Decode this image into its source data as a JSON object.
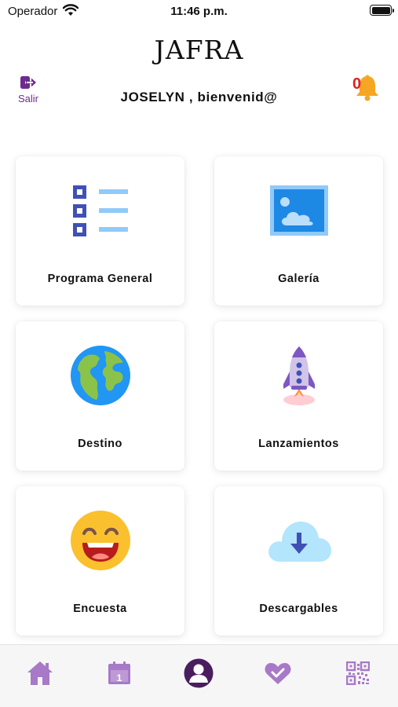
{
  "status_bar": {
    "carrier": "Operador",
    "time": "11:46 p.m."
  },
  "header": {
    "brand": "JAFRA",
    "logout_label": "Salir",
    "welcome": "JOSELYN , bienvenid@",
    "notification_count": "0"
  },
  "menu": {
    "items": [
      {
        "label": "Programa General",
        "icon": "checklist-icon"
      },
      {
        "label": "Galería",
        "icon": "picture-icon"
      },
      {
        "label": "Destino",
        "icon": "globe-icon"
      },
      {
        "label": "Lanzamientos",
        "icon": "rocket-icon"
      },
      {
        "label": "Encuesta",
        "icon": "smiley-icon"
      },
      {
        "label": "Descargables",
        "icon": "cloud-download-icon"
      }
    ]
  },
  "tab_bar": {
    "items": [
      "home-icon",
      "calendar-icon",
      "profile-icon",
      "favorites-icon",
      "qr-code-icon"
    ],
    "calendar_day": "1"
  },
  "colors": {
    "accent": "#6d2c8f",
    "tab_icon": "#a779c7",
    "bell": "#f5a623",
    "badge": "#e02020"
  }
}
